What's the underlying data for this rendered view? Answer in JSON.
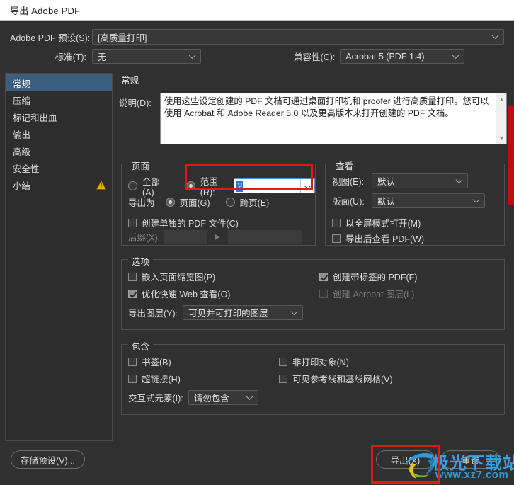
{
  "window": {
    "title": "导出 Adobe PDF"
  },
  "top": {
    "preset_label": "Adobe PDF 预设(S):",
    "preset_value": "[高质量打印]",
    "standard_label": "标准(T):",
    "standard_value": "无",
    "compat_label": "兼容性(C):",
    "compat_value": "Acrobat 5 (PDF 1.4)"
  },
  "sidebar": {
    "items": [
      {
        "label": "常规",
        "selected": true,
        "warning": false
      },
      {
        "label": "压缩",
        "selected": false,
        "warning": false
      },
      {
        "label": "标记和出血",
        "selected": false,
        "warning": false
      },
      {
        "label": "输出",
        "selected": false,
        "warning": false
      },
      {
        "label": "高级",
        "selected": false,
        "warning": false
      },
      {
        "label": "安全性",
        "selected": false,
        "warning": false
      },
      {
        "label": "小结",
        "selected": false,
        "warning": true
      }
    ]
  },
  "pane": {
    "title": "常规",
    "description_label": "说明(D):",
    "description_text": "使用这些设定创建的 PDF 文档可通过桌面打印机和 proofer 进行高质量打印。您可以使用 Acrobat 和 Adobe Reader 5.0 以及更高版本来打开创建的 PDF 文档。"
  },
  "pages_group": {
    "title": "页面",
    "all_label": "全部(A)",
    "range_label": "范围(R):",
    "range_value": "2",
    "export_as_label": "导出为",
    "export_pages_label": "页面(G)",
    "export_spreads_label": "跨页(E)",
    "create_separate_label": "创建单独的 PDF 文件(C)",
    "suffix_label": "后缀(X):",
    "suffix_value": "",
    "suffix_value2": ""
  },
  "view_group": {
    "title": "查看",
    "view_label": "视图(E):",
    "view_value": "默认",
    "layout_label": "版面(U):",
    "layout_value": "默认",
    "fullscreen_label": "以全屏模式打开(M)",
    "view_after_label": "导出后查看 PDF(W)"
  },
  "options_group": {
    "title": "选项",
    "embed_thumbs_label": "嵌入页面缩览图(P)",
    "optimize_web_label": "优化快速 Web 查看(O)",
    "create_tagged_label": "创建带标签的 PDF(F)",
    "create_acrobat_layers_label": "创建 Acrobat 图层(L)",
    "export_layers_label": "导出图层(Y):",
    "export_layers_value": "可见并可打印的图层"
  },
  "include_group": {
    "title": "包含",
    "bookmarks_label": "书签(B)",
    "hyperlinks_label": "超链接(H)",
    "nonprinting_label": "非打印对象(N)",
    "guides_label": "可见参考线和基线网格(V)",
    "interactive_label": "交互式元素(I):",
    "interactive_value": "请勿包含"
  },
  "footer": {
    "save_preset_label": "存储预设(V)...",
    "export_label": "导出(X)",
    "reset_label": "重置"
  },
  "watermark": {
    "brand": "极光下载站",
    "url": "www.xz7.com"
  },
  "colors": {
    "dialog_bg": "#303030",
    "titlebar_bg": "#ffffff",
    "sidebar_selected": "#3b5d80",
    "annotation_red": "#e01b16",
    "accent_blue": "#2a7ad4",
    "warning_amber": "#e8b10e"
  }
}
